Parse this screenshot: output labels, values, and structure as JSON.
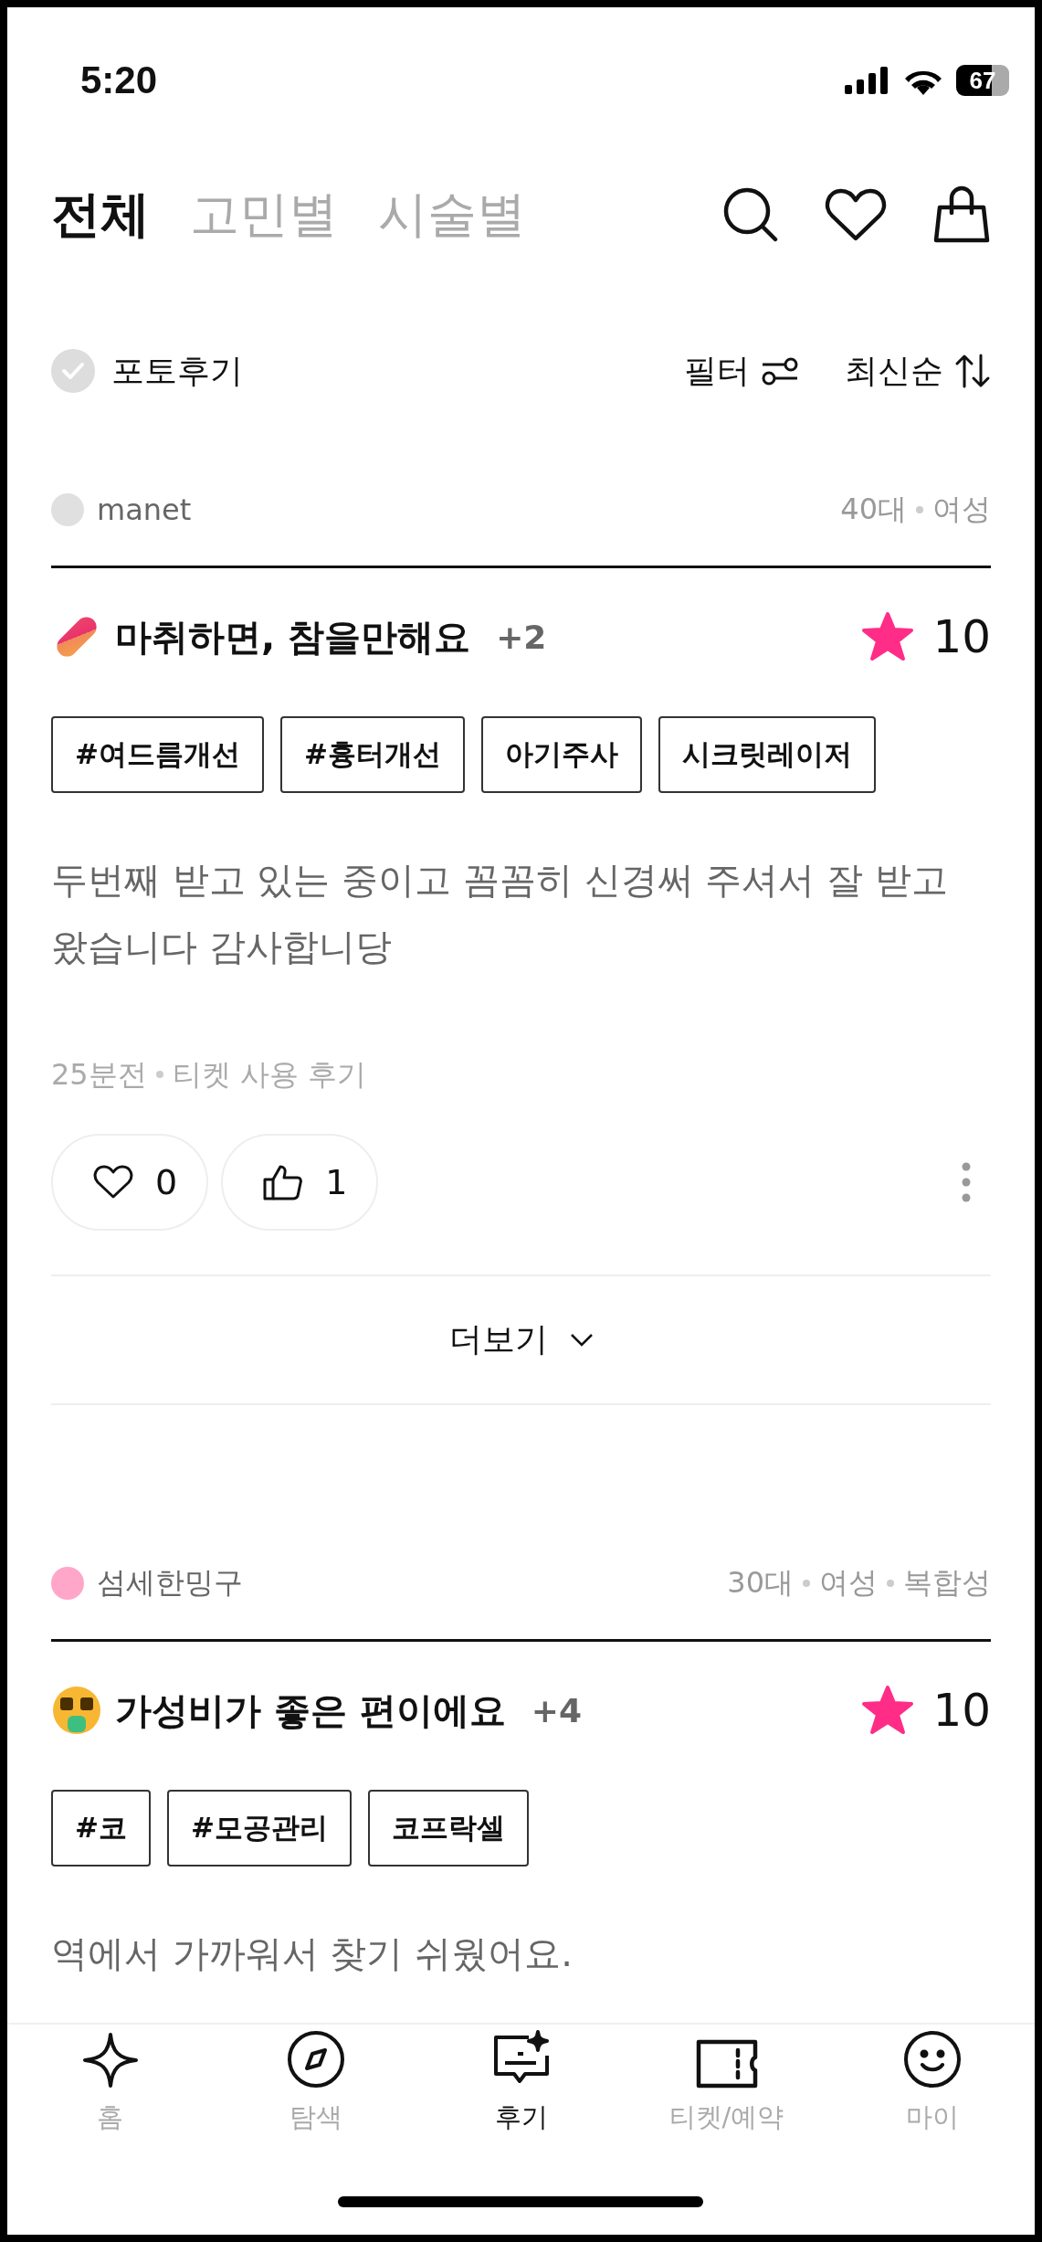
{
  "status_bar": {
    "time": "5:20",
    "battery": "67"
  },
  "tabs": [
    {
      "label": "전체",
      "selected": true
    },
    {
      "label": "고민별",
      "selected": false
    },
    {
      "label": "시술별",
      "selected": false
    }
  ],
  "filters": {
    "photo_review": {
      "label": "포토후기",
      "checked": false
    },
    "filter": "필터",
    "sort": "최신순"
  },
  "reviews": [
    {
      "user": "manet",
      "color": "#e0e0e0",
      "meta": [
        "40대",
        "여성"
      ],
      "kind": "pill",
      "title": "마취하면, 참을만해요",
      "extra": "+2",
      "rating": "10",
      "tags": [
        "#여드름개선",
        "#흉터개선",
        "아기주사",
        "시크릿레이저"
      ],
      "text": "두번째 받고 있는 중이고 꼼꼼히 신경써 주셔서 잘 받고 왔습니다 감사합니당",
      "time": "25분전",
      "source": "티켓 사용 후기",
      "likes": "0",
      "thumbs": "1",
      "more": "더보기"
    },
    {
      "user": "섬세한밍구",
      "color": "#ffa6c9",
      "meta": [
        "30대",
        "여성",
        "복합성"
      ],
      "kind": "money",
      "title": "가성비가 좋은 편이에요",
      "extra": "+4",
      "rating": "10",
      "tags": [
        "#코",
        "#모공관리",
        "코프락셀"
      ],
      "text": "역에서 가까워서 찾기 쉬웠어요."
    }
  ],
  "nav": [
    {
      "label": "홈",
      "kind": "sparkle",
      "selected": false
    },
    {
      "label": "탐색",
      "kind": "compass",
      "selected": false
    },
    {
      "label": "후기",
      "kind": "review",
      "selected": true
    },
    {
      "label": "티켓/예약",
      "kind": "ticket",
      "selected": false
    },
    {
      "label": "마이",
      "kind": "smile",
      "selected": false
    }
  ]
}
